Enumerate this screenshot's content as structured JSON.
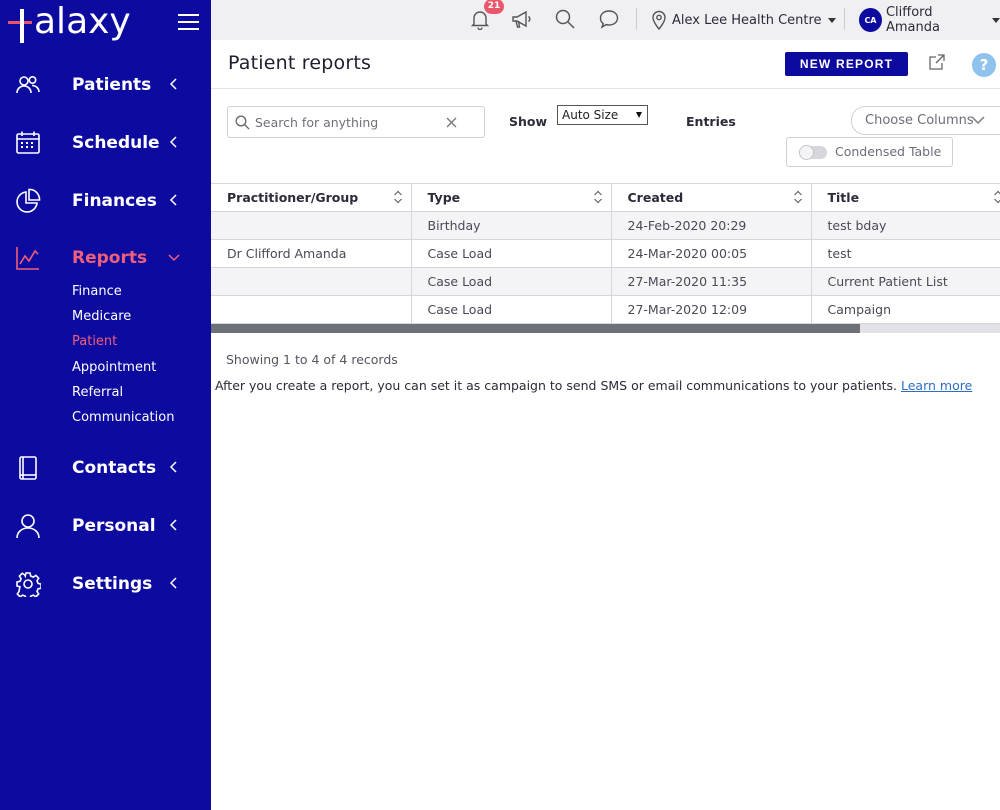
{
  "app": {
    "logo_text": "alaxy",
    "accent": "#ef5f7a",
    "brand": "#0d0aa0"
  },
  "sidebar": {
    "items": [
      {
        "label": "Patients",
        "icon": "patients-icon"
      },
      {
        "label": "Schedule",
        "icon": "calendar-icon"
      },
      {
        "label": "Finances",
        "icon": "pie-chart-icon"
      },
      {
        "label": "Reports",
        "icon": "line-chart-icon",
        "active": true
      },
      {
        "label": "Contacts",
        "icon": "book-icon"
      },
      {
        "label": "Personal",
        "icon": "person-icon"
      },
      {
        "label": "Settings",
        "icon": "gear-icon"
      }
    ],
    "reports_sub": [
      "Finance",
      "Medicare",
      "Patient",
      "Appointment",
      "Referral",
      "Communication"
    ],
    "active_sub": "Patient"
  },
  "topbar": {
    "notification_count": "21",
    "location": "Alex Lee Health Centre",
    "user_initials": "CA",
    "user_name": "Clifford Amanda"
  },
  "header": {
    "title": "Patient reports",
    "new_report_label": "NEW REPORT",
    "help_label": "?"
  },
  "controls": {
    "search_placeholder": "Search for anything",
    "show_label": "Show",
    "page_size": "Auto Size",
    "entries_label": "Entries",
    "choose_columns_label": "Choose Columns",
    "condensed_label": "Condensed Table"
  },
  "table": {
    "columns": [
      "Practitioner/Group",
      "Type",
      "Created",
      "Title"
    ],
    "rows": [
      [
        "",
        "Birthday",
        "24-Feb-2020 20:29",
        "test bday"
      ],
      [
        "Dr Clifford Amanda",
        "Case Load",
        "24-Mar-2020 00:05",
        "test"
      ],
      [
        "",
        "Case Load",
        "27-Mar-2020 11:35",
        "Current Patient List"
      ],
      [
        "",
        "Case Load",
        "27-Mar-2020 12:09",
        "Campaign"
      ]
    ]
  },
  "footer": {
    "records": "Showing 1 to 4 of 4 records",
    "info_text": "After you create a report, you can set it as campaign to send SMS or email communications to your patients.",
    "learn_more": "Learn more"
  }
}
